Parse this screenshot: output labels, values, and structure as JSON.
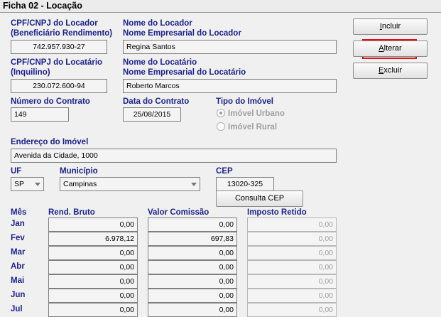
{
  "window": {
    "title": "Ficha 02 - Locação"
  },
  "buttons": {
    "incluir": {
      "prefix": "",
      "accel": "I",
      "rest": "ncluir"
    },
    "alterar": {
      "prefix": "",
      "accel": "A",
      "rest": "lterar"
    },
    "excluir": {
      "prefix": "",
      "accel": "E",
      "rest": "xcluir"
    },
    "consulta_cep": "Consulta CEP"
  },
  "locador": {
    "cpf_label_1": "CPF/CNPJ do Locador",
    "cpf_label_2": "(Beneficiário Rendimento)",
    "cpf_value": "742.957.930-27",
    "nome_label_1": "Nome do Locador",
    "nome_label_2": "Nome Empresarial do Locador",
    "nome_value": "Regina Santos"
  },
  "locatario": {
    "cpf_label_1": "CPF/CNPJ do Locatário",
    "cpf_label_2": "(Inquilino)",
    "cpf_value": "230.072.600-94",
    "nome_label_1": "Nome do Locatário",
    "nome_label_2": "Nome Empresarial do Locatário",
    "nome_value": "Roberto Marcos"
  },
  "contrato": {
    "numero_label": "Número do Contrato",
    "numero_value": "149",
    "data_label": "Data do Contrato",
    "data_value": "25/08/2015"
  },
  "imovel": {
    "tipo_label": "Tipo do Imóvel",
    "urbano": "Imóvel Urbano",
    "rural": "Imóvel Rural",
    "selected": "urbano",
    "endereco_label": "Endereço do Imóvel",
    "endereco_value": "Avenida da Cidade, 1000",
    "uf_label": "UF",
    "uf_value": "SP",
    "municipio_label": "Município",
    "municipio_value": "Campinas",
    "cep_label": "CEP",
    "cep_value": "13020-325"
  },
  "table": {
    "headers": {
      "mes": "Mês",
      "rend": "Rend. Bruto",
      "comissao": "Valor Comissão",
      "imposto": "Imposto Retido"
    },
    "rows": [
      {
        "mes": "Jan",
        "rend": "0,00",
        "comissao": "0,00",
        "imposto": "0,00"
      },
      {
        "mes": "Fev",
        "rend": "6.978,12",
        "comissao": "697,83",
        "imposto": "0,00"
      },
      {
        "mes": "Mar",
        "rend": "0,00",
        "comissao": "0,00",
        "imposto": "0,00"
      },
      {
        "mes": "Abr",
        "rend": "0,00",
        "comissao": "0,00",
        "imposto": "0,00"
      },
      {
        "mes": "Mai",
        "rend": "0,00",
        "comissao": "0,00",
        "imposto": "0,00"
      },
      {
        "mes": "Jun",
        "rend": "0,00",
        "comissao": "0,00",
        "imposto": "0,00"
      },
      {
        "mes": "Jul",
        "rend": "0,00",
        "comissao": "0,00",
        "imposto": "0,00"
      }
    ]
  },
  "colors": {
    "label": "#1a1f8f",
    "highlight": "#e01010"
  }
}
